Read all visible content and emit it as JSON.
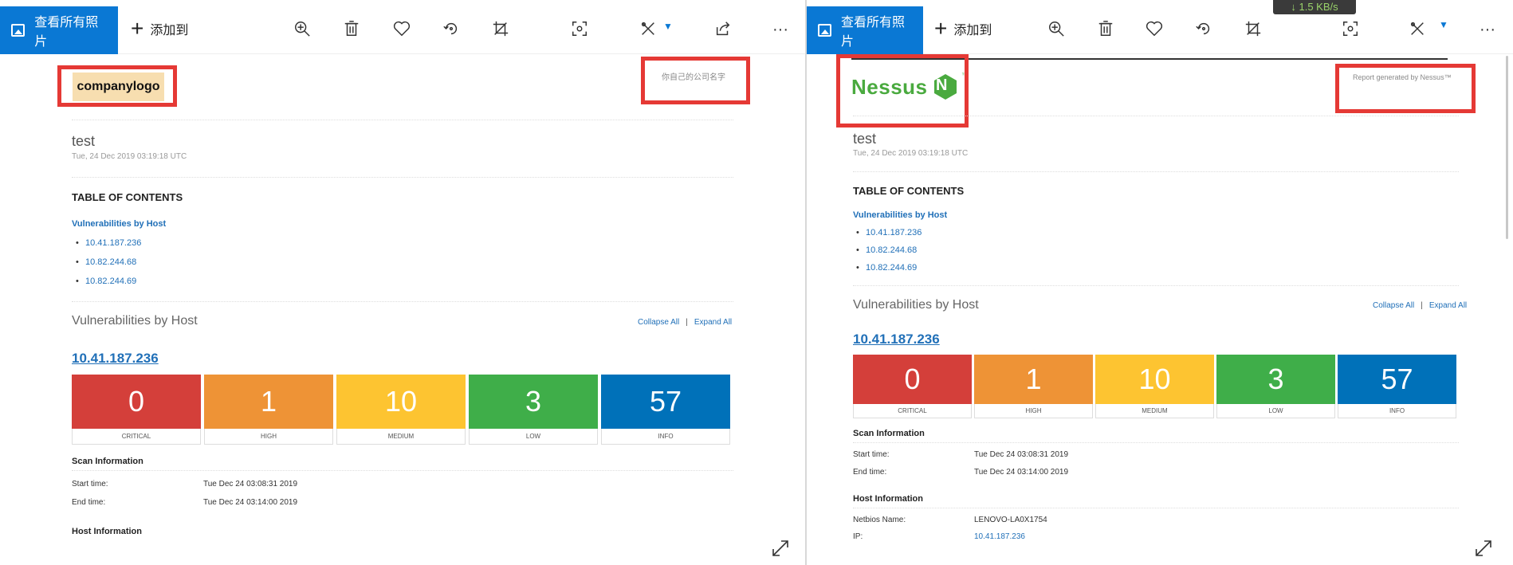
{
  "colors": {
    "accent": "#0a78d4",
    "critical": "#d43f3a",
    "high": "#ee9336",
    "medium": "#fdc431",
    "low": "#3fae49",
    "info": "#0071b9",
    "link": "#2170b8",
    "highlight_box": "#e53935",
    "nessus_green": "#4aaa3f"
  },
  "toolbar": {
    "view_all_label": "查看所有照片",
    "add_to_label": "添加到",
    "icons": [
      "zoom-in-icon",
      "delete-icon",
      "favorite-icon",
      "rotate-icon",
      "crop-icon",
      "screen-capture-icon",
      "edit-icon",
      "share-icon",
      "more-icon"
    ],
    "more_glyph": "···"
  },
  "network_speed": "↓ 1.5 KB/s",
  "left_report": {
    "logo_text": "companylogo",
    "company_name": "你自己的公司名字",
    "title": "test",
    "date": "Tue, 24 Dec 2019 03:19:18 UTC",
    "toc_heading": "TABLE OF CONTENTS",
    "toc_sub": "Vulnerabilities by Host",
    "toc_ips": [
      "10.41.187.236",
      "10.82.244.68",
      "10.82.244.69"
    ],
    "vbh_heading": "Vulnerabilities by Host",
    "collapse_all": "Collapse All",
    "link_sep": "|",
    "expand_all": "Expand All",
    "host_ip": "10.41.187.236",
    "severity": [
      {
        "count": "0",
        "label": "CRITICAL"
      },
      {
        "count": "1",
        "label": "HIGH"
      },
      {
        "count": "10",
        "label": "MEDIUM"
      },
      {
        "count": "3",
        "label": "LOW"
      },
      {
        "count": "57",
        "label": "INFO"
      }
    ],
    "scan_info_heading": "Scan Information",
    "start_time_label": "Start time:",
    "start_time_value": "Tue Dec 24 03:08:31 2019",
    "end_time_label": "End time:",
    "end_time_value": "Tue Dec 24 03:14:00 2019",
    "host_info_heading": "Host Information"
  },
  "right_report": {
    "logo_text": "Nessus",
    "logo_badge_letter": "N",
    "logo_tm": "™",
    "generated_by": "Report generated by Nessus™",
    "title": "test",
    "date": "Tue, 24 Dec 2019 03:19:18 UTC",
    "toc_heading": "TABLE OF CONTENTS",
    "toc_sub": "Vulnerabilities by Host",
    "toc_ips": [
      "10.41.187.236",
      "10.82.244.68",
      "10.82.244.69"
    ],
    "vbh_heading": "Vulnerabilities by Host",
    "collapse_all": "Collapse All",
    "link_sep": "|",
    "expand_all": "Expand All",
    "host_ip": "10.41.187.236",
    "severity": [
      {
        "count": "0",
        "label": "CRITICAL"
      },
      {
        "count": "1",
        "label": "HIGH"
      },
      {
        "count": "10",
        "label": "MEDIUM"
      },
      {
        "count": "3",
        "label": "LOW"
      },
      {
        "count": "57",
        "label": "INFO"
      }
    ],
    "scan_info_heading": "Scan Information",
    "start_time_label": "Start time:",
    "start_time_value": "Tue Dec 24 03:08:31 2019",
    "end_time_label": "End time:",
    "end_time_value": "Tue Dec 24 03:14:00 2019",
    "host_info_heading": "Host Information",
    "netbios_label": "Netbios Name:",
    "netbios_value": "LENOVO-LA0X1754",
    "ip_label": "IP:",
    "ip_value": "10.41.187.236"
  }
}
